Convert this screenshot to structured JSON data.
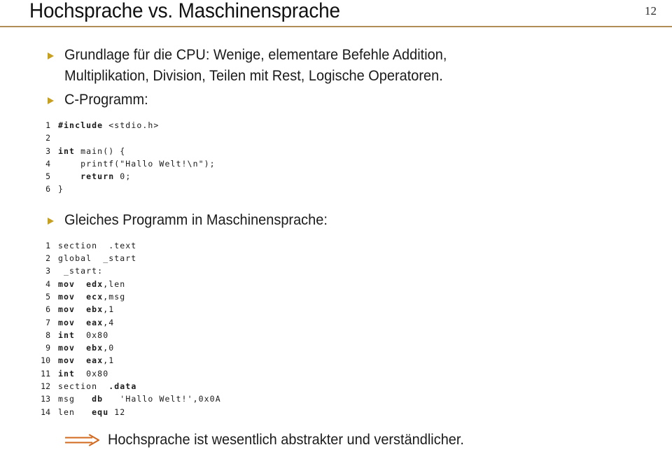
{
  "header": {
    "title": "Hochsprache vs. Maschinensprache",
    "page_number": "12",
    "rule_color": "#b08d57"
  },
  "theme": {
    "bullet_color": "#c8a020",
    "arrow_color": "#d2691e",
    "text_color": "#1b1b1b",
    "background": "#ffffff"
  },
  "body": {
    "bullets": [
      {
        "marker": "triangle-bullet-icon",
        "text": "Grundlage für die CPU: Wenige, elementare Befehle Addition,\nMultiplikation, Division, Teilen mit Rest, Logische Operatoren."
      },
      {
        "marker": "triangle-bullet-icon",
        "text": "C-Programm:"
      },
      {
        "marker": "triangle-bullet-icon",
        "text": "Gleiches Programm in Maschinensprache:"
      }
    ],
    "c_listing": {
      "language": "C",
      "lines": [
        {
          "no": "1",
          "segments": [
            {
              "t": "#include",
              "bold": true
            },
            {
              "t": " <stdio.h>",
              "bold": false
            }
          ]
        },
        {
          "no": "2",
          "segments": [
            {
              "t": "",
              "bold": false
            }
          ]
        },
        {
          "no": "3",
          "segments": [
            {
              "t": "int",
              "bold": true
            },
            {
              "t": " main() {",
              "bold": false
            }
          ]
        },
        {
          "no": "4",
          "segments": [
            {
              "t": "    printf(\"Hallo Welt!\\n\");",
              "bold": false
            }
          ]
        },
        {
          "no": "5",
          "segments": [
            {
              "t": "    ",
              "bold": false
            },
            {
              "t": "return",
              "bold": true
            },
            {
              "t": " 0;",
              "bold": false
            }
          ]
        },
        {
          "no": "6",
          "segments": [
            {
              "t": "}",
              "bold": false
            }
          ]
        }
      ]
    },
    "asm_listing": {
      "language": "Assembler",
      "lines": [
        {
          "no": "1",
          "segments": [
            {
              "t": "section  .text",
              "bold": false
            }
          ]
        },
        {
          "no": "2",
          "segments": [
            {
              "t": "global  _start",
              "bold": false
            }
          ]
        },
        {
          "no": "3",
          "segments": [
            {
              "t": " _start:",
              "bold": false
            }
          ]
        },
        {
          "no": "4",
          "segments": [
            {
              "t": "mov",
              "bold": true
            },
            {
              "t": "  ",
              "bold": false
            },
            {
              "t": "edx",
              "bold": true
            },
            {
              "t": ",len",
              "bold": false
            }
          ]
        },
        {
          "no": "5",
          "segments": [
            {
              "t": "mov",
              "bold": true
            },
            {
              "t": "  ",
              "bold": false
            },
            {
              "t": "ecx",
              "bold": true
            },
            {
              "t": ",msg",
              "bold": false
            }
          ]
        },
        {
          "no": "6",
          "segments": [
            {
              "t": "mov",
              "bold": true
            },
            {
              "t": "  ",
              "bold": false
            },
            {
              "t": "ebx",
              "bold": true
            },
            {
              "t": ",1",
              "bold": false
            }
          ]
        },
        {
          "no": "7",
          "segments": [
            {
              "t": "mov",
              "bold": true
            },
            {
              "t": "  ",
              "bold": false
            },
            {
              "t": "eax",
              "bold": true
            },
            {
              "t": ",4",
              "bold": false
            }
          ]
        },
        {
          "no": "8",
          "segments": [
            {
              "t": "int",
              "bold": true
            },
            {
              "t": "  0x80",
              "bold": false
            }
          ]
        },
        {
          "no": "9",
          "segments": [
            {
              "t": "mov",
              "bold": true
            },
            {
              "t": "  ",
              "bold": false
            },
            {
              "t": "ebx",
              "bold": true
            },
            {
              "t": ",0",
              "bold": false
            }
          ]
        },
        {
          "no": "10",
          "segments": [
            {
              "t": "mov",
              "bold": true
            },
            {
              "t": "  ",
              "bold": false
            },
            {
              "t": "eax",
              "bold": true
            },
            {
              "t": ",1",
              "bold": false
            }
          ]
        },
        {
          "no": "11",
          "segments": [
            {
              "t": "int",
              "bold": true
            },
            {
              "t": "  0x80",
              "bold": false
            }
          ]
        },
        {
          "no": "12",
          "segments": [
            {
              "t": "section  ",
              "bold": false
            },
            {
              "t": ".data",
              "bold": true
            }
          ]
        },
        {
          "no": "13",
          "segments": [
            {
              "t": "msg   ",
              "bold": false
            },
            {
              "t": "db",
              "bold": true
            },
            {
              "t": "   'Hallo Welt!',0x0A",
              "bold": false
            }
          ]
        },
        {
          "no": "14",
          "segments": [
            {
              "t": "len   ",
              "bold": false
            },
            {
              "t": "equ",
              "bold": true
            },
            {
              "t": " 12",
              "bold": false
            }
          ]
        }
      ]
    },
    "conclusion": {
      "arrow": "implies-right-arrow-icon",
      "text": "Hochsprache ist wesentlich abstrakter und verständlicher."
    }
  }
}
